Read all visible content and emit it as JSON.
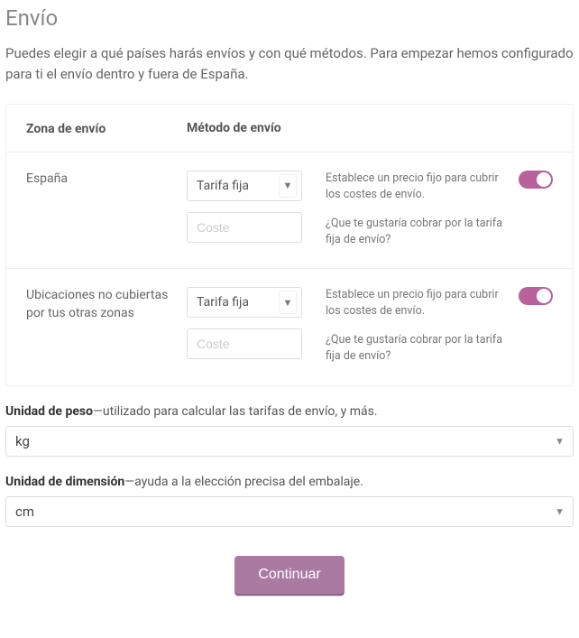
{
  "title": "Envío",
  "intro": "Puedes elegir a qué países harás envíos y con qué métodos. Para empezar hemos configurado para ti el envío dentro y fuera de España.",
  "headers": {
    "zone": "Zona de envío",
    "method": "Método de envío"
  },
  "zones": [
    {
      "name": "España",
      "method_selected": "Tarifa fija",
      "cost_placeholder": "Coste",
      "desc1": "Establece un precio fijo para cubrir los costes de envío.",
      "desc2": "¿Que te gustaría cobrar por la tarifa fija de envío?",
      "enabled": true
    },
    {
      "name": "Ubicaciones no cubiertas por tus otras zonas",
      "method_selected": "Tarifa fija",
      "cost_placeholder": "Coste",
      "desc1": "Establece un precio fijo para cubrir los costes de envío.",
      "desc2": "¿Que te gustaría cobrar por la tarifa fija de envío?",
      "enabled": true
    }
  ],
  "units": {
    "weight": {
      "label": "Unidad de peso",
      "help": "—utilizado para calcular las tarifas de envío, y más.",
      "value": "kg"
    },
    "dimension": {
      "label": "Unidad de dimensión",
      "help": "—ayuda a la elección precisa del embalaje.",
      "value": "cm"
    }
  },
  "actions": {
    "continue": "Continuar"
  }
}
